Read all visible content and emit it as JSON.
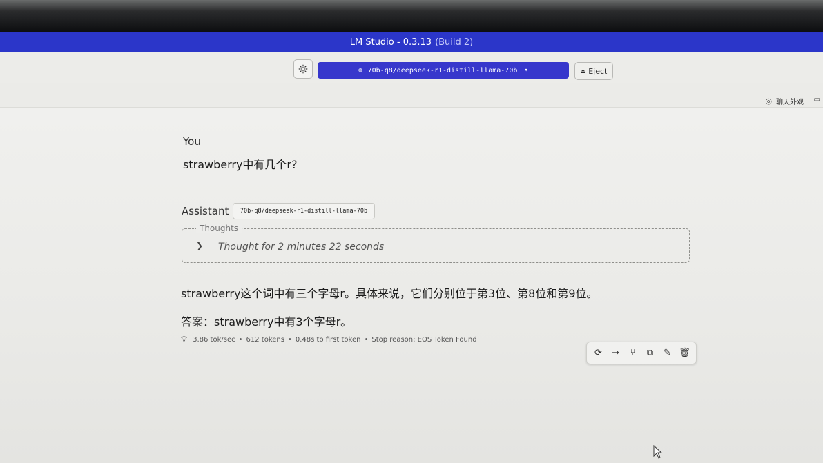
{
  "window": {
    "title": "LM Studio - 0.3.13",
    "build": "(Build 2)"
  },
  "toolbar": {
    "settings_icon": "gear-icon",
    "model_selected": "70b-q8/deepseek-r1-distill-llama-70b",
    "eject_label": "Eject"
  },
  "subbar": {
    "appearance_label": "聊天外观"
  },
  "chat": {
    "user_role": "You",
    "user_message": "strawberry中有几个r?",
    "assistant_role": "Assistant",
    "assistant_model": "70b-q8/deepseek-r1-distill-llama-70b",
    "thoughts_label": "Thoughts",
    "thoughts_summary": "Thought for 2 minutes 22 seconds",
    "answer_line1": "strawberry这个词中有三个字母r。具体来说，它们分别位于第3位、第8位和第9位。",
    "answer_line2": "答案：strawberry中有3个字母r。"
  },
  "stats": {
    "speed": "3.86 tok/sec",
    "tokens": "612 tokens",
    "first_token": "0.48s to first token",
    "stop_reason": "Stop reason: EOS Token Found"
  },
  "colors": {
    "titlebar": "#2b36c9",
    "model_select": "#3737cc"
  },
  "actions": [
    "regenerate-icon",
    "continue-icon",
    "branch-icon",
    "copy-icon",
    "edit-icon",
    "delete-icon"
  ]
}
